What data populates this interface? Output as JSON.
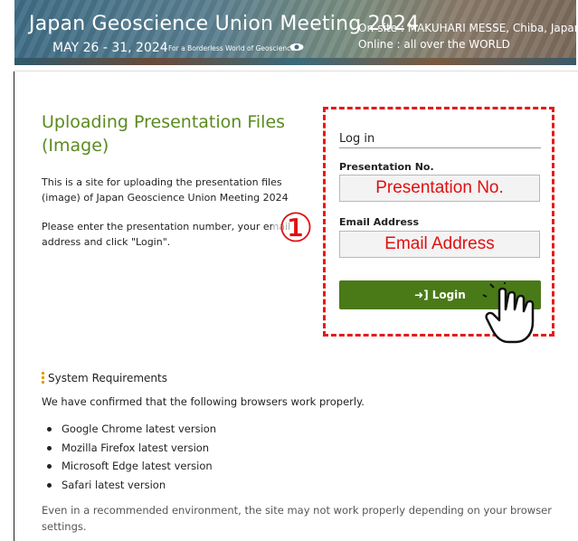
{
  "banner": {
    "title": "Japan Geoscience Union Meeting 2024",
    "dates": "MAY 26 - 31, 2024",
    "slogan": "For a Borderless World of Geoscience",
    "onsite": "On-site : MAKUHARI MESSE, Chiba, Japan",
    "online": "Online : all over the WORLD"
  },
  "main": {
    "title": "Uploading Presentation Files (Image)",
    "description": "This is a site for uploading the presentation files (image) of Japan Geoscience Union Meeting 2024",
    "instruction": "Please enter the presentation number, your email address and click \"Login\".",
    "step_marker": "①"
  },
  "login": {
    "heading": "Log in",
    "presentation_label": "Presentation No.",
    "presentation_value": "Presentation No.",
    "email_label": "Email Address",
    "email_value": "Email Address",
    "button_label": "Login",
    "button_icon": "sign-in-icon",
    "highlight_color": "#e31b1b",
    "button_color": "#4a7a18"
  },
  "requirements": {
    "heading": "System Requirements",
    "intro": "We have confirmed that the following browsers work properly.",
    "browsers": [
      "Google Chrome latest version",
      "Mozilla Firefox latest version",
      "Microsoft Edge latest version",
      "Safari latest version"
    ],
    "note": "Even in a recommended environment, the site may not work properly depending on your browser settings."
  },
  "colors": {
    "title_green": "#5b8a1f",
    "annotation_red": "#e01010"
  }
}
